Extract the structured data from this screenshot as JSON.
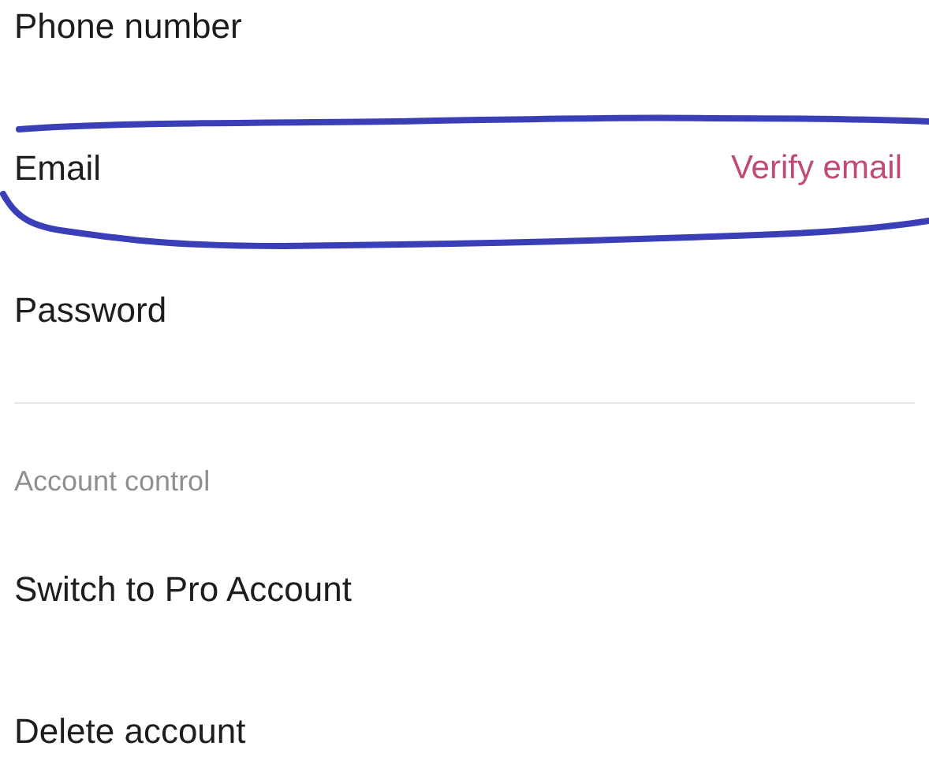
{
  "account_rows": [
    {
      "label": "Phone number",
      "circled": false
    },
    {
      "label": "Email",
      "action": "Verify email",
      "circled": true
    },
    {
      "label": "Password",
      "circled": false
    }
  ],
  "account_control": {
    "heading": "Account control",
    "rows": [
      {
        "label": "Switch to Pro Account"
      },
      {
        "label": "Delete account"
      }
    ]
  }
}
